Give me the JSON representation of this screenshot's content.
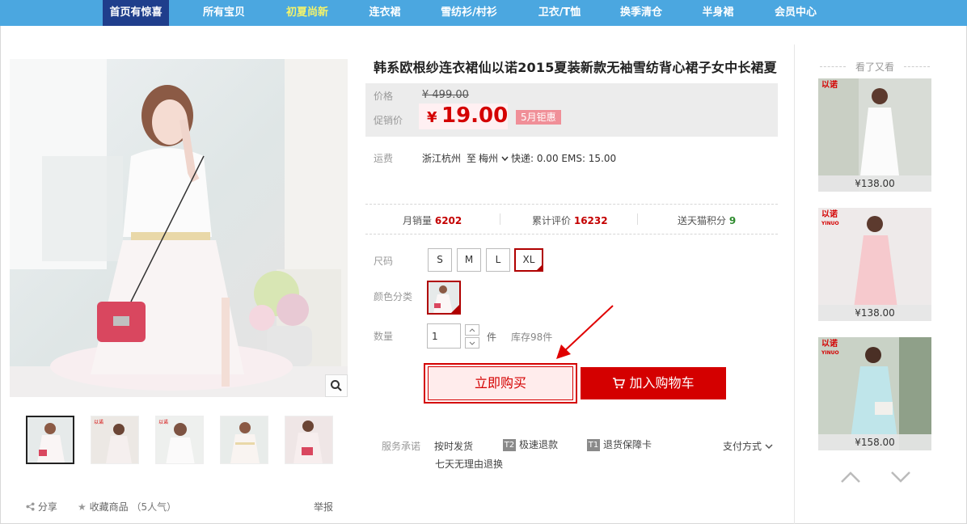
{
  "nav": {
    "items": [
      {
        "label": "首页有惊喜"
      },
      {
        "label": "所有宝贝"
      },
      {
        "label": "初夏尚新"
      },
      {
        "label": "连衣裙"
      },
      {
        "label": "雪纺衫/村衫"
      },
      {
        "label": "卫衣/T恤"
      },
      {
        "label": "换季清仓"
      },
      {
        "label": "半身裙"
      },
      {
        "label": "会员中心"
      }
    ]
  },
  "product": {
    "title": "韩系欧根纱连衣裙仙以诺2015夏装新款无袖雪纺背心裙子女中长裙夏",
    "price_label": "价格",
    "original_price": "¥ 499.00",
    "promo_label": "促销价",
    "promo_currency": "¥",
    "promo_price": "19.00",
    "promo_badge": "5月钜惠",
    "shipping": {
      "label": "运费",
      "from": "浙江杭州",
      "to_word": "至",
      "dest": "梅州",
      "detail": "快递: 0.00 EMS: 15.00"
    },
    "stats": {
      "monthly_label": "月销量",
      "monthly_value": "6202",
      "reviews_label": "累计评价",
      "reviews_value": "16232",
      "points_label": "送天猫积分",
      "points_value": "9"
    },
    "size_label": "尺码",
    "sizes": [
      "S",
      "M",
      "L",
      "XL"
    ],
    "selected_size": "XL",
    "color_label": "颜色分类",
    "qty_label": "数量",
    "qty_value": "1",
    "qty_unit": "件",
    "stock": "库存98件",
    "buy_now": "立即购买",
    "add_cart": "加入购物车",
    "service": {
      "label": "服务承诺",
      "items": [
        "按时发货",
        "极速退款",
        "退货保障卡",
        "七天无理由退换"
      ],
      "badges": [
        "T2",
        "T1"
      ],
      "payment": "支付方式"
    }
  },
  "gallery": {
    "share": "分享",
    "favorite": "收藏商品",
    "popularity": "（5人气）",
    "report": "举报"
  },
  "sidebar": {
    "title": "看了又看",
    "logo": "以诺",
    "logo_sub": "YINUO",
    "items": [
      {
        "price": "¥138.00"
      },
      {
        "price": "¥138.00"
      },
      {
        "price": "¥158.00"
      }
    ]
  },
  "colors": {
    "nav_bg": "#4ba7e0",
    "nav_home_bg": "#1f3e8c",
    "accent_red": "#d40000",
    "nav_highlight": "#f3f36b"
  }
}
